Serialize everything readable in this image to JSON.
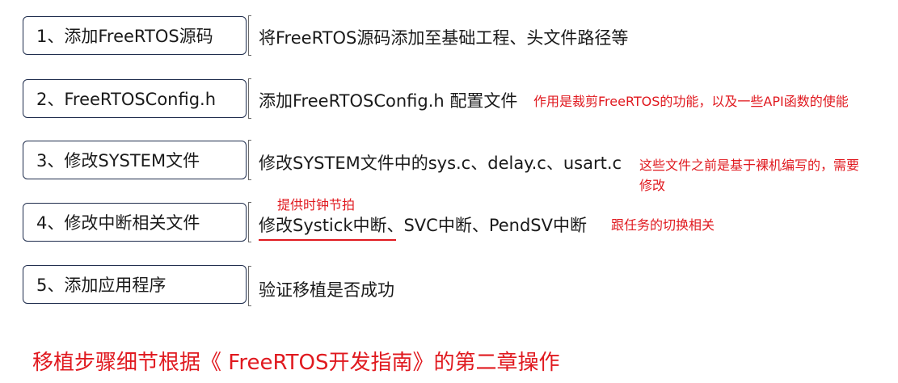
{
  "steps": [
    {
      "label": "1、添加FreeRTOS源码",
      "desc": "将FreeRTOS源码添加至基础工程、头文件路径等"
    },
    {
      "label": "2、FreeRTOSConfig.h",
      "desc": "添加FreeRTOSConfig.h 配置文件",
      "note": "作用是裁剪FreeRTOS的功能，以及一些API函数的使能"
    },
    {
      "label": "3、修改SYSTEM文件",
      "desc": "修改SYSTEM文件中的sys.c、delay.c、usart.c",
      "note_line1": "这些文件之前是基于裸机编写的，需要",
      "note_line2": "修改"
    },
    {
      "label": "4、修改中断相关文件",
      "desc": "修改Systick中断、SVC中断、PendSV中断",
      "note_above": "提供时钟节拍",
      "note": "跟任务的切换相关"
    },
    {
      "label": "5、添加应用程序",
      "desc": "验证移植是否成功"
    }
  ],
  "footer": "移植步骤细节根据《 FreeRTOS开发指南》的第二章操作",
  "colors": {
    "box_border": "#1f2d4d",
    "bracket": "#6a6a6a",
    "annotation": "#e0191f"
  }
}
